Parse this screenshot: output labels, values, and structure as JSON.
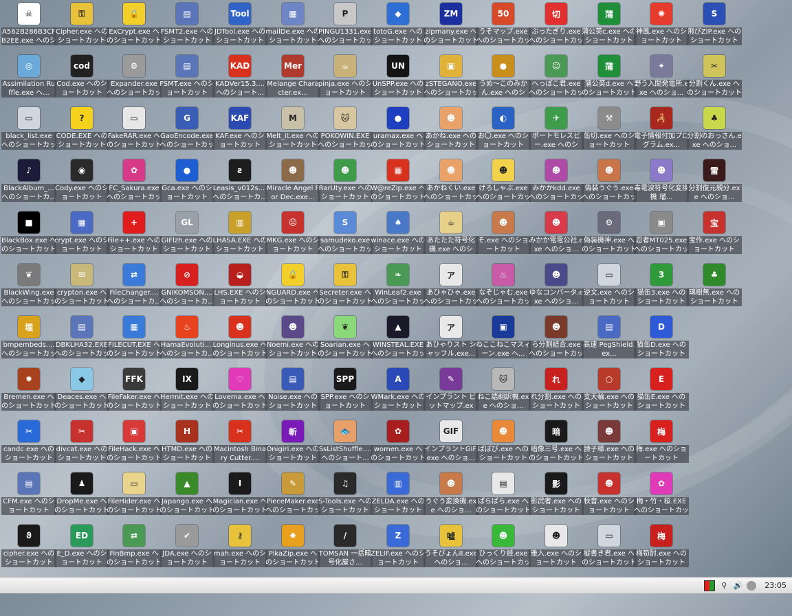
{
  "icons": [
    {
      "label": "A562B286B3CFB2EE.exe へのショートカット",
      "glyph": "☠",
      "color": "#ffffff"
    },
    {
      "label": "Cipher.exe へのショートカット (2)",
      "glyph": "⚿",
      "color": "#e8c23a"
    },
    {
      "label": "ExCrypt.exe へのショートカット",
      "glyph": "🔒",
      "color": "#f2cf2a"
    },
    {
      "label": "FSMT2.exe へのショートカット",
      "glyph": "▤",
      "color": "#5a76b8"
    },
    {
      "label": "JDTool.exe へのショートカット",
      "glyph": "Tool",
      "color": "#2f63c7"
    },
    {
      "label": "mailDe.exe へのショートカット",
      "glyph": "▦",
      "color": "#6f86c6"
    },
    {
      "label": "PINGU1331.exe へのショートカット",
      "glyph": "P",
      "color": "#c8c8c8"
    },
    {
      "label": "totoG.exe へのショートカット",
      "glyph": "◆",
      "color": "#2e6fd6"
    },
    {
      "label": "zipmany.exe へのショートカット",
      "glyph": "ZM",
      "color": "#1c2f9f"
    },
    {
      "label": "うそマップ.exe へのショートカット",
      "glyph": "50",
      "color": "#d64a2a"
    },
    {
      "label": "ぶったぎり.exe へのショートカット",
      "glyph": "切",
      "color": "#e23030"
    },
    {
      "label": "蒲公英c.exe へのショートカット",
      "glyph": "蒲",
      "color": "#1f8f3a"
    },
    {
      "label": "神風.exe へのショートカット",
      "glyph": "✺",
      "color": "#e63c2e"
    },
    {
      "label": "飛びZIP.exe へのショートカット",
      "glyph": "S",
      "color": "#2c4fb5"
    },
    {
      "label": "Assimilation Ruffle.exe へ...",
      "glyph": "◎",
      "color": "#6aa9d8"
    },
    {
      "label": "Cod.exe へのショートカット",
      "glyph": "cod",
      "color": "#222222"
    },
    {
      "label": "Expander.exe へのショートカット",
      "glyph": "⚙",
      "color": "#9a9a9a"
    },
    {
      "label": "FSMT.exe へのショートカット",
      "glyph": "▤",
      "color": "#5a76b8"
    },
    {
      "label": "KADVer15.3....へのショート...",
      "glyph": "KAD",
      "color": "#d8321e"
    },
    {
      "label": "Melange Character.ex...",
      "glyph": "Mer",
      "color": "#b03a2e"
    },
    {
      "label": "pinja.exe へのショートカット",
      "glyph": "☕",
      "color": "#c9b27a"
    },
    {
      "label": "UnSPP.exe へのショートカット",
      "glyph": "UN",
      "color": "#151515"
    },
    {
      "label": "zSTEGANO.exe へのショートカット",
      "glyph": "▣",
      "color": "#e0b23a"
    },
    {
      "label": "うめ〜このみかん.exe へのショ...",
      "glyph": "●",
      "color": "#c98f1c"
    },
    {
      "label": "へっぽこ君.exe へのショートカット",
      "glyph": "☺",
      "color": "#4a9a55"
    },
    {
      "label": "蒲公英d.exe へのショートカット",
      "glyph": "蒲",
      "color": "#1f8f3a"
    },
    {
      "label": "野う入間発電所.exe へのショ...",
      "glyph": "✦",
      "color": "#7a7a9a"
    },
    {
      "label": "分割くん.exe へのショートカット",
      "glyph": "✂",
      "color": "#cfc45a"
    },
    {
      "label": "black_list.exe へのショートカット",
      "glyph": "▭",
      "color": "#cfd6de"
    },
    {
      "label": "CODE.EXE へのショートカット",
      "glyph": "?",
      "color": "#f4d21c"
    },
    {
      "label": "FakeRAR.exe へのショートカット",
      "glyph": "▭",
      "color": "#e7e7e7"
    },
    {
      "label": "GaoEncode.exe へのショートカット",
      "glyph": "G",
      "color": "#3a5db5"
    },
    {
      "label": "KAF.exe へのショートカット",
      "glyph": "KAF",
      "color": "#2b4bb0"
    },
    {
      "label": "Melt_it.exe へのショートカット",
      "glyph": "M",
      "color": "#c9c0a8"
    },
    {
      "label": "POKOWIN.EXE へのショートカット",
      "glyph": "🐱",
      "color": "#d7c7a0"
    },
    {
      "label": "uramax.exe へのショートカット",
      "glyph": "●",
      "color": "#1e3fbf"
    },
    {
      "label": "あかね.exe へのショートカット",
      "glyph": "☻",
      "color": "#e9a26a"
    },
    {
      "label": "お〇.exe へのショートカット",
      "glyph": "◐",
      "color": "#2b63c4"
    },
    {
      "label": "ポートモレスビー.exe へのショ...",
      "glyph": "✈",
      "color": "#3f9c4b"
    },
    {
      "label": "缶切.exe へのショートカット",
      "glyph": "⚒",
      "color": "#8c8c8c"
    },
    {
      "label": "電子情報付加プログラム.ex...",
      "glyph": "🦂",
      "color": "#a8271e"
    },
    {
      "label": "分割のおっさん.exe へのショ...",
      "glyph": "♣",
      "color": "#c8d84a"
    },
    {
      "label": "BlackAlbum_...へのショートカ...",
      "glyph": "♪",
      "color": "#1c1c3a"
    },
    {
      "label": "Cody.exe へのショートカット",
      "glyph": "◉",
      "color": "#2a2a2a"
    },
    {
      "label": "FC_Sakura.exe へのショートカット",
      "glyph": "✿",
      "color": "#d83a8a"
    },
    {
      "label": "Gca.exe へのショートカット",
      "glyph": "●",
      "color": "#1d5fd2"
    },
    {
      "label": "Leasis_v012s....へのショートカ...",
      "glyph": "ƨ",
      "color": "#1d1d1d"
    },
    {
      "label": "Miracle Angel For Dec.exe...",
      "glyph": "☻",
      "color": "#8b6b4a"
    },
    {
      "label": "RarUty.exe へのショートカット",
      "glyph": "☻",
      "color": "#3f9c4b"
    },
    {
      "label": "W@reZip.exe へのショートカット",
      "glyph": "▦",
      "color": "#d8321e"
    },
    {
      "label": "あかねくい.exe へのショートカット",
      "glyph": "☻",
      "color": "#e9a26a"
    },
    {
      "label": "げろしゃぶ.exe へのショートカット",
      "glyph": "☻",
      "color": "#f2d24a"
    },
    {
      "label": "みかかkdd.exe へのショートカット",
      "glyph": "☻",
      "color": "#b04aa8"
    },
    {
      "label": "偽装うぐう.exe へのショートカット",
      "glyph": "☻",
      "color": "#c9754a"
    },
    {
      "label": "毒電波符号化変換機 瑠...",
      "glyph": "☻",
      "color": "#8a7ac8"
    },
    {
      "label": "分割復元親分.exe へのショ...",
      "glyph": "雷",
      "color": "#3a1a1a"
    },
    {
      "label": "BlackBox.exe へのショートカット",
      "glyph": "■",
      "color": "#000000"
    },
    {
      "label": "crypt.exe へのショートカット",
      "glyph": "▦",
      "color": "#4a6ac4"
    },
    {
      "label": "File++.exe へのショートカット",
      "glyph": "+",
      "color": "#e01c1c"
    },
    {
      "label": "GIFlzh.exe へのショートカット",
      "glyph": "GL",
      "color": "#9aa0a8"
    },
    {
      "label": "LHASA.EXE へのショートカット",
      "glyph": "▥",
      "color": "#c8a02a"
    },
    {
      "label": "MKG.exe へのショートカット",
      "glyph": "☹",
      "color": "#c8322e"
    },
    {
      "label": "samudeko.exe へのショートカット",
      "glyph": "S",
      "color": "#5a8ad8"
    },
    {
      "label": "winace.exe へのショートカット",
      "glyph": "♠",
      "color": "#4a78c8"
    },
    {
      "label": "あたたた符号化機.exe へのショ...",
      "glyph": "☕",
      "color": "#e6d08a"
    },
    {
      "label": "そ.exe へのショートカット",
      "glyph": "☻",
      "color": "#c97a4a"
    },
    {
      "label": "みかか電電公社.exe へのショ...",
      "glyph": "☻",
      "color": "#d83a4a"
    },
    {
      "label": "偽装機神.exe へのショートカット",
      "glyph": "⚙",
      "color": "#6a6a7a"
    },
    {
      "label": "忍者MT025.exe へのショートカット",
      "glyph": "▣",
      "color": "#8a8a8a"
    },
    {
      "label": "宝作.exe へのショートカット",
      "glyph": "宝",
      "color": "#c8322e"
    },
    {
      "label": "BlackWing.exe へのショートカット",
      "glyph": "❦",
      "color": "#7a7a7a"
    },
    {
      "label": "crypton.exe へのショートカット",
      "glyph": "✉",
      "color": "#c8b87a"
    },
    {
      "label": "FileChanger....へのショートカ...",
      "glyph": "⇄",
      "color": "#3a7ad8"
    },
    {
      "label": "GNIKOMSON....へのショートカ...",
      "glyph": "⊘",
      "color": "#d8201e"
    },
    {
      "label": "LHS.EXE へのショートカット",
      "glyph": "◒",
      "color": "#b8201e"
    },
    {
      "label": "NGUARD.exe へのショートカット",
      "glyph": "🔒",
      "color": "#f2cf2a"
    },
    {
      "label": "Secreter.exe へのショートカット",
      "glyph": "⚿",
      "color": "#e8c23a"
    },
    {
      "label": "WinLeaf2.exe へのショートカット",
      "glyph": "❧",
      "color": "#4a9a55"
    },
    {
      "label": "あひゃひゃ.exe へのショートカット",
      "glyph": "ア",
      "color": "#e8e8e8"
    },
    {
      "label": "なぞじゃむ.exe へのショートカット",
      "glyph": "♨",
      "color": "#c85aa8"
    },
    {
      "label": "ゆなコンバータ.exe へのショ...",
      "glyph": "☻",
      "color": "#4a4a8a"
    },
    {
      "label": "逆文.exe へのショートカット",
      "glyph": "▭",
      "color": "#cfd6de"
    },
    {
      "label": "猫缶3.exe へのショートカット",
      "glyph": "3",
      "color": "#2e9a3a"
    },
    {
      "label": "璃樹無.exe へのショートカット",
      "glyph": "♣",
      "color": "#2e8a2a"
    },
    {
      "label": "bmpembeds....へのショートカット",
      "glyph": "埋",
      "color": "#d8a21c"
    },
    {
      "label": "DBKLHA32.EXE へのショートカット",
      "glyph": "▤",
      "color": "#5a76b8"
    },
    {
      "label": "FILECUT.EXE へのショートカット",
      "glyph": "▦",
      "color": "#3a7ad8"
    },
    {
      "label": "HamaEvoluti....へのショートカ...",
      "glyph": "♨",
      "color": "#e8421e"
    },
    {
      "label": "Longinus.exe へのショートカット",
      "glyph": "☻",
      "color": "#d8321e"
    },
    {
      "label": "Noemi.exe へのショートカット",
      "glyph": "☻",
      "color": "#5a4a8a"
    },
    {
      "label": "Soarian.exe へのショートカット",
      "glyph": "❦",
      "color": "#8ad87a"
    },
    {
      "label": "WINSTEAL.EXE へのショートカット",
      "glyph": "▲",
      "color": "#1a1a2a"
    },
    {
      "label": "あひゃりスト シャッフル.exe...",
      "glyph": "ア",
      "color": "#e8e8e8"
    },
    {
      "label": "ねここねこマスィーン.exe へ...",
      "glyph": "▣",
      "color": "#1a3a9a"
    },
    {
      "label": "ら分割結合.exe へのショートカット",
      "glyph": "☻",
      "color": "#7a3a2a"
    },
    {
      "label": "高速 PegShield.ex...",
      "glyph": "▤",
      "color": "#4a6ac4"
    },
    {
      "label": "猫缶D.exe へのショートカット",
      "glyph": "D",
      "color": "#2e5ad8"
    },
    {
      "label": "Bremen.exe へのショートカット",
      "glyph": "✹",
      "color": "#a8421e"
    },
    {
      "label": "Deaces.exe へのショートカット",
      "glyph": "◆",
      "color": "#8ac8e8"
    },
    {
      "label": "FileFaker.exe へのショートカット",
      "glyph": "FFK",
      "color": "#3a3a3a"
    },
    {
      "label": "Hermit.exe へのショートカット",
      "glyph": "IX",
      "color": "#1a1a1a"
    },
    {
      "label": "Lovema.exe へのショートカット",
      "glyph": "♡",
      "color": "#e03ab8"
    },
    {
      "label": "Noise.exe へのショートカット",
      "glyph": "▤",
      "color": "#3a5ab8"
    },
    {
      "label": "SPP.exe へのショートカット",
      "glyph": "SPP",
      "color": "#1a1a1a"
    },
    {
      "label": "WMark.exe へのショートカット",
      "glyph": "A",
      "color": "#2a4ab8"
    },
    {
      "label": "インプラント ビットマップ.exe...",
      "glyph": "✎",
      "color": "#7a3a9a"
    },
    {
      "label": "ねこ語翻訳機.exe へのショ...",
      "glyph": "🐱",
      "color": "#b8b8b8"
    },
    {
      "label": "れ分割.exe へのショートカット",
      "glyph": "れ",
      "color": "#c8201e"
    },
    {
      "label": "支天輪.exe へのショートカット",
      "glyph": "○",
      "color": "#b83a2a"
    },
    {
      "label": "猫缶E.exe へのショートカット",
      "glyph": "E",
      "color": "#d8201e"
    },
    {
      "label": "candc.exe へのショートカット",
      "glyph": "✂",
      "color": "#2a6ad8"
    },
    {
      "label": "divcat.exe へのショートカット",
      "glyph": "✂",
      "color": "#c8322e"
    },
    {
      "label": "FileHack.exe へのショートカット",
      "glyph": "▣",
      "color": "#d83a3a"
    },
    {
      "label": "HTMD.exe へのショートカット",
      "glyph": "H",
      "color": "#a8321e"
    },
    {
      "label": "Macintosh Binary Cutter....",
      "glyph": "✂",
      "color": "#d8321e"
    },
    {
      "label": "Onigiri.exe へのショートカット",
      "glyph": "斬",
      "color": "#7a1ab8"
    },
    {
      "label": "SsListShuffle....へのショート...",
      "glyph": "🐟",
      "color": "#e8a06a"
    },
    {
      "label": "women.exe へのショートカット",
      "glyph": "✿",
      "color": "#a81e1e"
    },
    {
      "label": "インプラントGIF.exe へのショ...",
      "glyph": "GIF",
      "color": "#e8e8e8"
    },
    {
      "label": "ばぼび.exe へのショートカット",
      "glyph": "☻",
      "color": "#e88a3a"
    },
    {
      "label": "暗像三号.exe へのショートカット",
      "glyph": "暗",
      "color": "#1a1a1a"
    },
    {
      "label": "詩子様.exe へのショートカット",
      "glyph": "☻",
      "color": "#7a3a3a"
    },
    {
      "label": "梅.exe へのショートカット",
      "glyph": "梅",
      "color": "#d8201e"
    },
    {
      "label": "CFM.exe へのショートカット",
      "glyph": "▤",
      "color": "#5a76b8"
    },
    {
      "label": "DropMe.exe へのショートカット",
      "glyph": "♟",
      "color": "#1a1a1a"
    },
    {
      "label": "FileHider.exe へのショートカット",
      "glyph": "▭",
      "color": "#e8d48a"
    },
    {
      "label": "Japango.exe へのショートカット",
      "glyph": "▲",
      "color": "#3a8a2a"
    },
    {
      "label": "Magician.exe へのショートカット",
      "glyph": "I",
      "color": "#1a1a1a"
    },
    {
      "label": "PieceMaker.exe へのショートカット",
      "glyph": "✎",
      "color": "#c89a3a"
    },
    {
      "label": "S-Tools.exe へのショートカット",
      "glyph": "♫",
      "color": "#2a2a2a"
    },
    {
      "label": "ZELDA.exe へのショートカット",
      "glyph": "▥",
      "color": "#3a6ad8"
    },
    {
      "label": "うぐう変換機.exe へのショ...",
      "glyph": "☻",
      "color": "#c97a4a"
    },
    {
      "label": "ぱらぱら.exe へのショートカット",
      "glyph": "▤",
      "color": "#e8e8e8"
    },
    {
      "label": "影武者.exe へのショートカット",
      "glyph": "影",
      "color": "#1a1a1a"
    },
    {
      "label": "秋音.exe へのショートカット",
      "glyph": "☻",
      "color": "#c8322e"
    },
    {
      "label": "梅・竹・桜.EXE へのショートカット",
      "glyph": "✿",
      "color": "#e03ab8"
    },
    {
      "label": "cipher.exe へのショートカット",
      "glyph": "ϑ",
      "color": "#1a1a1a"
    },
    {
      "label": "E_D.exe へのショートカット",
      "glyph": "ED",
      "color": "#2a9a5a"
    },
    {
      "label": "FinBmp.exe へのショートカット",
      "glyph": "⇄",
      "color": "#4a9a55"
    },
    {
      "label": "JDA.exe へのショートカット",
      "glyph": "✔",
      "color": "#9a9a9a"
    },
    {
      "label": "mah.exe へのショートカット",
      "glyph": "⚷",
      "color": "#e8c23a"
    },
    {
      "label": "PikaZip.exe へのショートカット",
      "glyph": "✸",
      "color": "#e8a01e"
    },
    {
      "label": "TOMSAN 一括暗号化屋さ...",
      "glyph": "/",
      "color": "#2a2a2a"
    },
    {
      "label": "ZELIF.exe へのショートカット",
      "glyph": "Z",
      "color": "#3a6ad8"
    },
    {
      "label": "うそぴょんII.exe へのショ...",
      "glyph": "嘘",
      "color": "#e8c23a"
    },
    {
      "label": "ひっくり蛙.exe へのショートカット",
      "glyph": "☻",
      "color": "#3ab83a"
    },
    {
      "label": "雅入.exe へのショートカット",
      "glyph": "☻",
      "color": "#e8e8e8"
    },
    {
      "label": "縦書き君.exe へのショートカット",
      "glyph": "▭",
      "color": "#cfd6de"
    },
    {
      "label": "梅筍酎.exe へのショートカット",
      "glyph": "梅",
      "color": "#c8201e"
    }
  ],
  "taskbar": {
    "start_glyph": "",
    "tray_icons": [
      "colors-icon",
      "network-icon",
      "volume-icon",
      "power-icon"
    ],
    "clock": "23:05"
  }
}
